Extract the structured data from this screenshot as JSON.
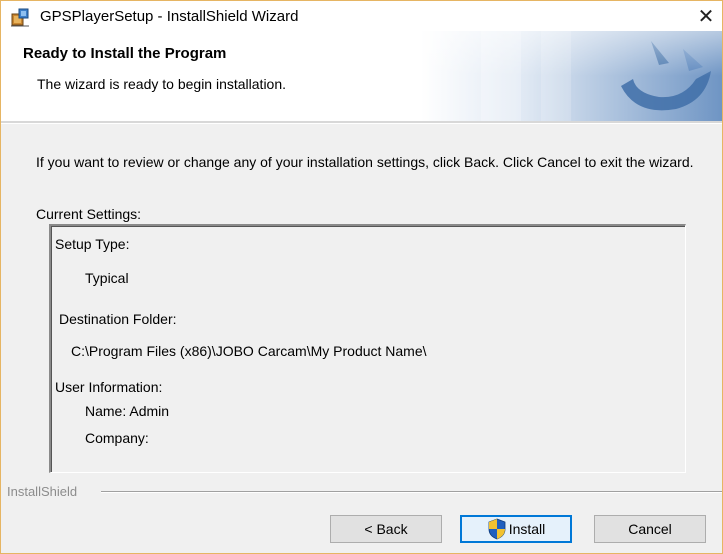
{
  "window": {
    "title": "GPSPlayerSetup - InstallShield Wizard",
    "close_glyph": "✕"
  },
  "banner": {
    "title": "Ready to Install the Program",
    "subtitle": "The wizard is ready to begin installation."
  },
  "body": {
    "instructions": "If you want to review or change any of your installation settings, click Back. Click Cancel to exit the wizard.",
    "current_settings_label": "Current Settings:",
    "settings": {
      "setup_type_label": "Setup Type:",
      "setup_type_value": "Typical",
      "destination_label": "Destination Folder:",
      "destination_value": "C:\\Program Files (x86)\\JOBO Carcam\\My Product Name\\",
      "user_info_label": "User Information:",
      "name_value": "Name: Admin",
      "company_value": "Company:"
    }
  },
  "footer": {
    "brand": "InstallShield",
    "back_label": "< Back",
    "install_label": "Install",
    "cancel_label": "Cancel"
  },
  "icons": {
    "app": "installer-icon",
    "close": "close-icon",
    "shield": "uac-shield-icon"
  },
  "colors": {
    "dialog_bg": "#f0f0f0",
    "banner_bg": "#ffffff",
    "banner_art": "#3f6fa8",
    "accent": "#0078d7",
    "window_border": "#e6b563"
  }
}
